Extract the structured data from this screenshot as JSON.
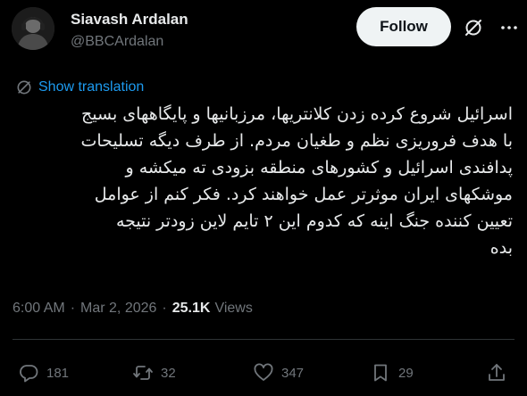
{
  "author": {
    "name": "Siavash Ardalan",
    "handle": "@BBCArdalan"
  },
  "header": {
    "follow_label": "Follow"
  },
  "translation": {
    "label": "Show translation"
  },
  "tweet": {
    "lines": [
      "اسرائیل شروع کرده زدن  کلانتریها، مرزبانیها و پایگاههای بسیج",
      "با  هدف فروریزی نظم و طغیان مردم. از طرف دیگه تسلیحات",
      "پدافندی اسرائیل و کشورهای منطقه بزودی ته میکشه و",
      "موشکهای ایران موثرتر عمل خواهند کرد. فکر کنم از  عوامل",
      "تعیین کننده جنگ اینه که کدوم این ۲ تایم لاین زودتر نتیجه",
      "بده"
    ]
  },
  "meta": {
    "time": "6:00 AM",
    "separator": "·",
    "date": "Mar 2, 2026",
    "views_count": "25.1K",
    "views_label": "Views"
  },
  "actions": {
    "replies": "181",
    "reposts": "32",
    "likes": "347",
    "bookmarks": "29"
  },
  "colors": {
    "background": "#000000",
    "text": "#e7e9ea",
    "muted": "#71767b",
    "link": "#1d9bf0",
    "follow_bg": "#eff3f4"
  },
  "icons": {
    "grok": "grok-icon",
    "more": "more-icon",
    "translate": "translate-icon",
    "reply": "reply-icon",
    "repost": "repost-icon",
    "like": "heart-icon",
    "bookmark": "bookmark-icon",
    "share": "share-icon"
  }
}
